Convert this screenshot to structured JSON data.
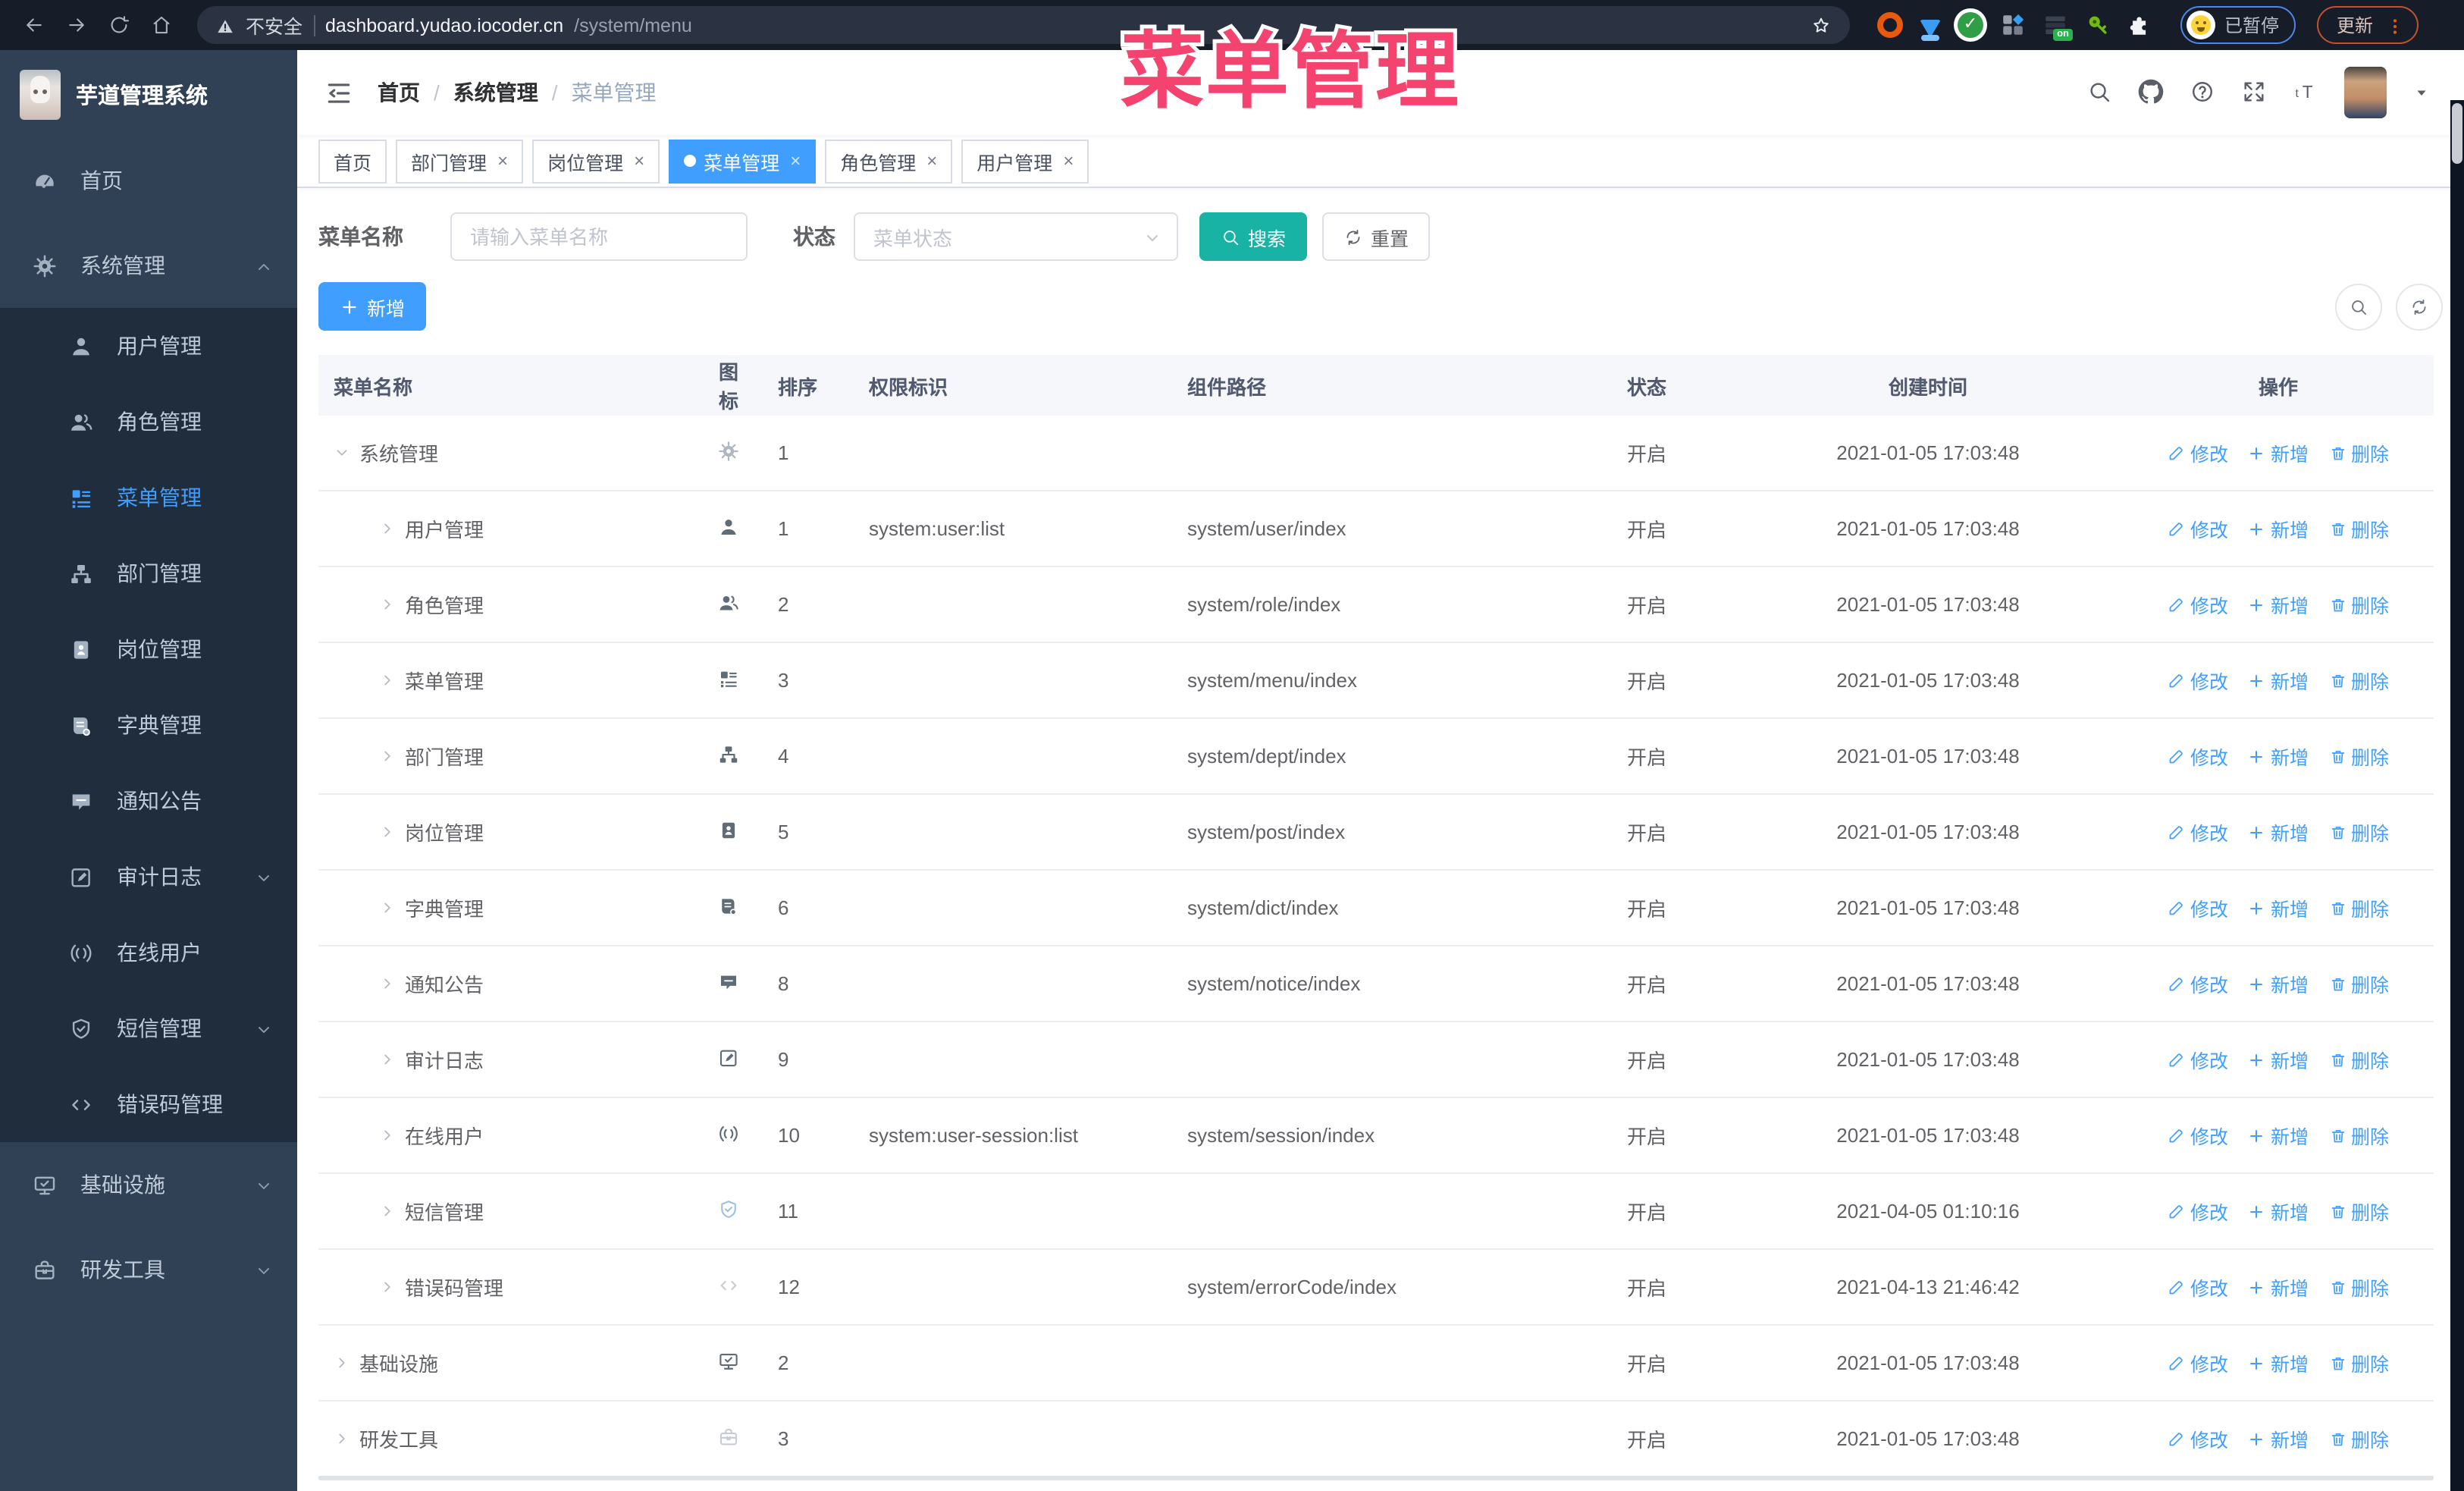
{
  "overlay": {
    "title": "菜单管理",
    "color": "#f4436f"
  },
  "browser": {
    "security_label": "不安全",
    "url_host": "dashboard.yudao.iocoder.cn",
    "url_path": "/system/menu",
    "profile_status": "已暂停",
    "update_label": "更新",
    "extension_on_badge": "on"
  },
  "sidebar": {
    "app_title": "芋道管理系统",
    "items": [
      {
        "key": "home",
        "label": "首页",
        "icon": "gauge",
        "type": "root"
      },
      {
        "key": "system",
        "label": "系统管理",
        "icon": "gear",
        "type": "root",
        "arrow": "up",
        "expanded": true
      },
      {
        "key": "user",
        "label": "用户管理",
        "icon": "user",
        "type": "child"
      },
      {
        "key": "role",
        "label": "角色管理",
        "icon": "users",
        "type": "child"
      },
      {
        "key": "menu",
        "label": "菜单管理",
        "icon": "menu-tree",
        "type": "child",
        "active": true
      },
      {
        "key": "dept",
        "label": "部门管理",
        "icon": "org-tree",
        "type": "child"
      },
      {
        "key": "post",
        "label": "岗位管理",
        "icon": "badge",
        "type": "child"
      },
      {
        "key": "dict",
        "label": "字典管理",
        "icon": "dict-book",
        "type": "child"
      },
      {
        "key": "notice",
        "label": "通知公告",
        "icon": "message",
        "type": "child"
      },
      {
        "key": "auditlog",
        "label": "审计日志",
        "icon": "edit-square",
        "type": "child",
        "arrow": "down"
      },
      {
        "key": "online",
        "label": "在线用户",
        "icon": "online",
        "type": "child"
      },
      {
        "key": "sms",
        "label": "短信管理",
        "icon": "shield-check",
        "type": "child",
        "arrow": "down"
      },
      {
        "key": "errorcode",
        "label": "错误码管理",
        "icon": "code",
        "type": "child"
      },
      {
        "key": "infra",
        "label": "基础设施",
        "icon": "monitor",
        "type": "root",
        "arrow": "down"
      },
      {
        "key": "devtools",
        "label": "研发工具",
        "icon": "toolbox",
        "type": "root",
        "arrow": "down"
      }
    ]
  },
  "header": {
    "breadcrumb": [
      {
        "label": "首页"
      },
      {
        "label": "系统管理"
      },
      {
        "label": "菜单管理",
        "current": true
      }
    ]
  },
  "tabs": [
    {
      "key": "home",
      "label": "首页",
      "closable": false,
      "active": false
    },
    {
      "key": "dept",
      "label": "部门管理",
      "closable": true,
      "active": false
    },
    {
      "key": "post",
      "label": "岗位管理",
      "closable": true,
      "active": false
    },
    {
      "key": "menu",
      "label": "菜单管理",
      "closable": true,
      "active": true
    },
    {
      "key": "role",
      "label": "角色管理",
      "closable": true,
      "active": false
    },
    {
      "key": "user",
      "label": "用户管理",
      "closable": true,
      "active": false
    }
  ],
  "filters": {
    "name_label": "菜单名称",
    "name_placeholder": "请输入菜单名称",
    "status_label": "状态",
    "status_placeholder": "菜单状态",
    "search_label": "搜索",
    "reset_label": "重置"
  },
  "toolbar": {
    "add_label": "新增"
  },
  "table": {
    "columns": [
      "菜单名称",
      "图标",
      "排序",
      "权限标识",
      "组件路径",
      "状态",
      "创建时间",
      "操作"
    ],
    "actions": {
      "edit": "修改",
      "add": "新增",
      "delete": "删除"
    },
    "rows": [
      {
        "name": "系统管理",
        "level": 0,
        "expanded": true,
        "icon": "gear",
        "icon_tone": "muted",
        "sort": "1",
        "perm": "",
        "component": "",
        "status": "开启",
        "created": "2021-01-05 17:03:48"
      },
      {
        "name": "用户管理",
        "level": 1,
        "expanded": false,
        "icon": "user",
        "icon_tone": "",
        "sort": "1",
        "perm": "system:user:list",
        "component": "system/user/index",
        "status": "开启",
        "created": "2021-01-05 17:03:48"
      },
      {
        "name": "角色管理",
        "level": 1,
        "expanded": false,
        "icon": "users",
        "icon_tone": "",
        "sort": "2",
        "perm": "",
        "component": "system/role/index",
        "status": "开启",
        "created": "2021-01-05 17:03:48"
      },
      {
        "name": "菜单管理",
        "level": 1,
        "expanded": false,
        "icon": "menu-tree",
        "icon_tone": "",
        "sort": "3",
        "perm": "",
        "component": "system/menu/index",
        "status": "开启",
        "created": "2021-01-05 17:03:48"
      },
      {
        "name": "部门管理",
        "level": 1,
        "expanded": false,
        "icon": "org-tree",
        "icon_tone": "",
        "sort": "4",
        "perm": "",
        "component": "system/dept/index",
        "status": "开启",
        "created": "2021-01-05 17:03:48"
      },
      {
        "name": "岗位管理",
        "level": 1,
        "expanded": false,
        "icon": "badge",
        "icon_tone": "",
        "sort": "5",
        "perm": "",
        "component": "system/post/index",
        "status": "开启",
        "created": "2021-01-05 17:03:48"
      },
      {
        "name": "字典管理",
        "level": 1,
        "expanded": false,
        "icon": "dict-book",
        "icon_tone": "",
        "sort": "6",
        "perm": "",
        "component": "system/dict/index",
        "status": "开启",
        "created": "2021-01-05 17:03:48"
      },
      {
        "name": "通知公告",
        "level": 1,
        "expanded": false,
        "icon": "message",
        "icon_tone": "",
        "sort": "8",
        "perm": "",
        "component": "system/notice/index",
        "status": "开启",
        "created": "2021-01-05 17:03:48"
      },
      {
        "name": "审计日志",
        "level": 1,
        "expanded": false,
        "icon": "edit-square",
        "icon_tone": "",
        "sort": "9",
        "perm": "",
        "component": "",
        "status": "开启",
        "created": "2021-01-05 17:03:48"
      },
      {
        "name": "在线用户",
        "level": 1,
        "expanded": false,
        "icon": "online",
        "icon_tone": "",
        "sort": "10",
        "perm": "system:user-session:list",
        "component": "system/session/index",
        "status": "开启",
        "created": "2021-01-05 17:03:48"
      },
      {
        "name": "短信管理",
        "level": 1,
        "expanded": false,
        "icon": "shield-check",
        "icon_tone": "light-blue",
        "sort": "11",
        "perm": "",
        "component": "",
        "status": "开启",
        "created": "2021-04-05 01:10:16"
      },
      {
        "name": "错误码管理",
        "level": 1,
        "expanded": false,
        "icon": "code",
        "icon_tone": "light",
        "sort": "12",
        "perm": "",
        "component": "system/errorCode/index",
        "status": "开启",
        "created": "2021-04-13 21:46:42"
      },
      {
        "name": "基础设施",
        "level": 0,
        "expanded": false,
        "icon": "monitor",
        "icon_tone": "",
        "sort": "2",
        "perm": "",
        "component": "",
        "status": "开启",
        "created": "2021-01-05 17:03:48"
      },
      {
        "name": "研发工具",
        "level": 0,
        "expanded": false,
        "icon": "toolbox",
        "icon_tone": "light",
        "sort": "3",
        "perm": "",
        "component": "",
        "status": "开启",
        "created": "2021-01-05 17:03:48"
      }
    ]
  },
  "colors": {
    "accent_blue": "#409eff",
    "search_button_teal": "#18b3a4",
    "sidebar_bg": "#304156",
    "submenu_bg": "#1f2d3d",
    "overlay_pink": "#f4436f",
    "browser_bar_bg": "#161c28"
  }
}
